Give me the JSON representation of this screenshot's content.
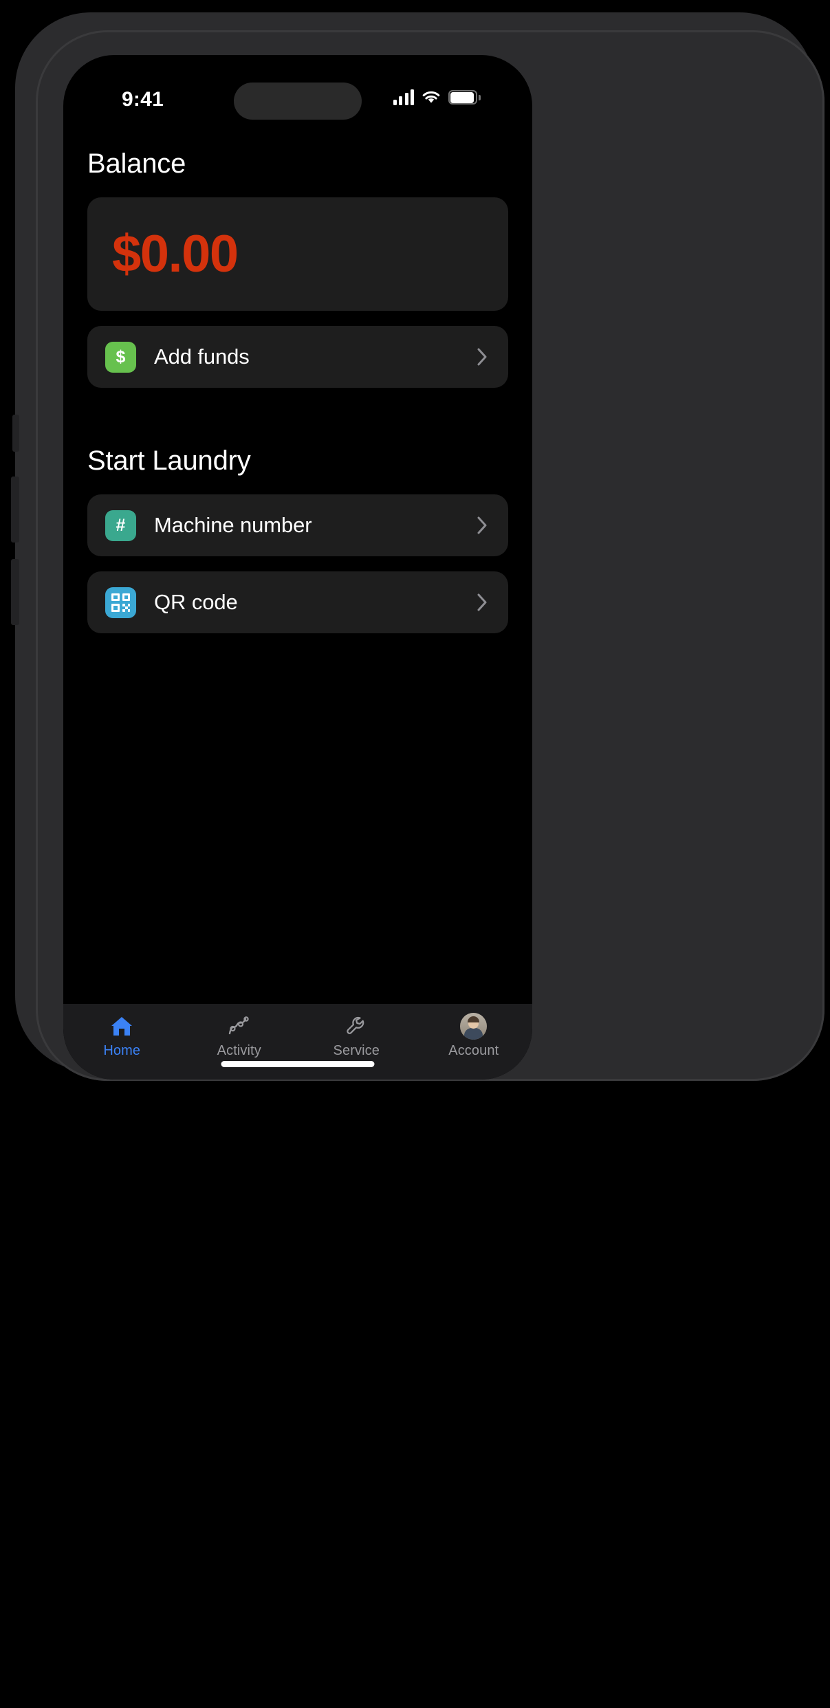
{
  "status_bar": {
    "time": "9:41",
    "signal_icon": "cellular-signal-icon",
    "wifi_icon": "wifi-icon",
    "battery_icon": "battery-icon"
  },
  "balance_section": {
    "title": "Balance",
    "amount": "$0.00",
    "amount_color": "#d4320c",
    "add_funds": {
      "label": "Add funds",
      "icon_glyph": "$",
      "icon_color": "#67c14e",
      "chevron": "chevron-right-icon"
    }
  },
  "laundry_section": {
    "title": "Start Laundry",
    "options": [
      {
        "label": "Machine number",
        "icon_glyph": "#",
        "icon_color": "#3aa88e",
        "icon_name": "hash-icon",
        "chevron": "chevron-right-icon"
      },
      {
        "label": "QR code",
        "icon_glyph": "",
        "icon_color": "#3ba8d4",
        "icon_name": "qr-code-icon",
        "chevron": "chevron-right-icon"
      }
    ]
  },
  "tab_bar": {
    "active_color": "#3b82f6",
    "inactive_color": "#9a9a9e",
    "tabs": [
      {
        "label": "Home",
        "icon": "home-icon",
        "active": true
      },
      {
        "label": "Activity",
        "icon": "activity-chart-icon",
        "active": false
      },
      {
        "label": "Service",
        "icon": "wrench-icon",
        "active": false
      },
      {
        "label": "Account",
        "icon": "avatar-photo",
        "active": false
      }
    ]
  }
}
